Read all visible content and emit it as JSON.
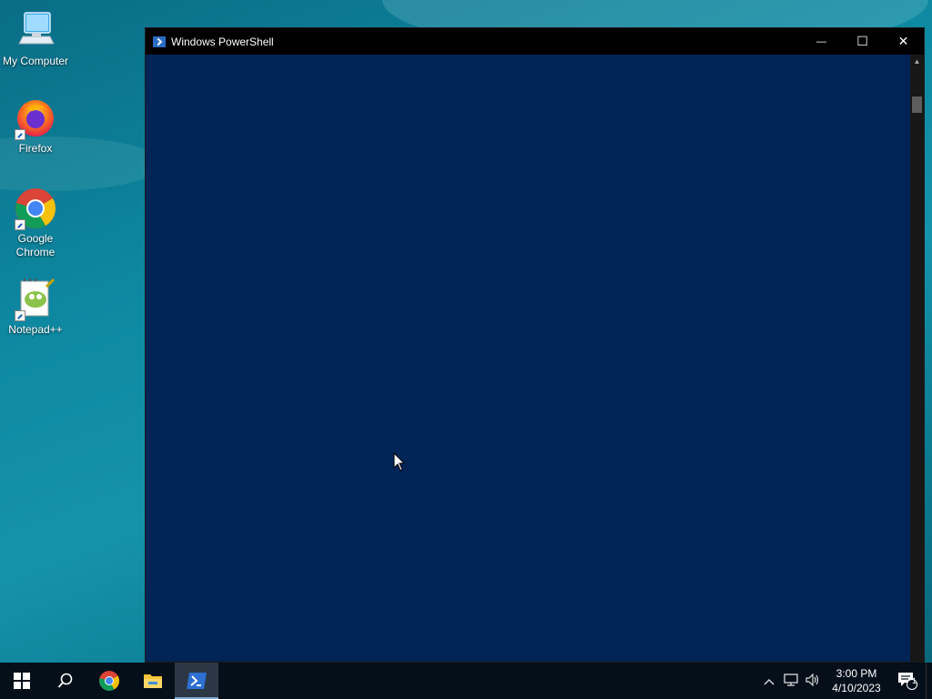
{
  "desktop": {
    "icons": [
      {
        "label": "My Computer",
        "icon": "computer-icon"
      },
      {
        "label": "Firefox",
        "icon": "firefox-icon"
      },
      {
        "label": "Google Chrome",
        "icon": "chrome-icon"
      },
      {
        "label": "Notepad++",
        "icon": "notepadpp-icon"
      }
    ]
  },
  "window": {
    "title": "Windows PowerShell",
    "minimize_glyph": "—",
    "maximize_glyph": "☐",
    "close_glyph": "✕",
    "background": "#012456"
  },
  "taskbar": {
    "items": [
      {
        "name": "start",
        "icon": "windows-logo-icon"
      },
      {
        "name": "search",
        "icon": "search-icon"
      },
      {
        "name": "chrome",
        "icon": "chrome-icon"
      },
      {
        "name": "file-explorer",
        "icon": "folder-icon"
      },
      {
        "name": "powershell",
        "icon": "powershell-icon",
        "active": true
      }
    ],
    "tray": {
      "chevron": "^",
      "time": "3:00 PM",
      "date": "4/10/2023",
      "notification_count": "1"
    }
  },
  "colors": {
    "accent": "#7aa9d6",
    "taskbar": "#050f1a",
    "powershell_blue": "#012456"
  }
}
